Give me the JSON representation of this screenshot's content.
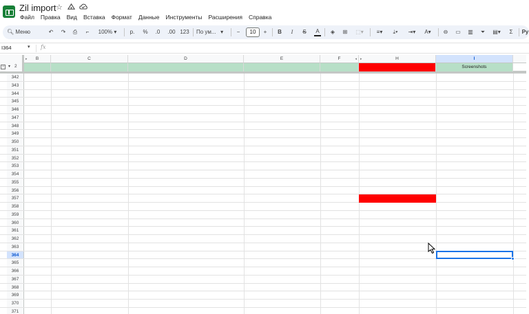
{
  "app": {
    "doc_title": "Zil import",
    "title_icons": [
      "star-icon",
      "move-to-folder-icon",
      "cloud-saved-icon"
    ],
    "menu": [
      "Файл",
      "Правка",
      "Вид",
      "Вставка",
      "Формат",
      "Данные",
      "Инструменты",
      "Расширения",
      "Справка"
    ]
  },
  "toolbar": {
    "search_label": "Меню",
    "zoom": "100%",
    "currency": "р.",
    "percent": "%",
    "dec_decrease": ".0",
    "dec_increase": ".00",
    "number_format": "123",
    "font_name": "По ум...",
    "font_size": "10",
    "bold": "B",
    "italic": "I",
    "strike": "S",
    "text_color": "A",
    "truncated_label": "Py"
  },
  "formula_bar": {
    "cell_ref": "I364",
    "fx": "fx",
    "value": ""
  },
  "sheet": {
    "columns": [
      "B",
      "C",
      "D",
      "E",
      "F",
      "H",
      "I"
    ],
    "selected_column": "I",
    "group_row_number": "2",
    "group_header_label": "Screenshots",
    "rows": [
      "342",
      "343",
      "344",
      "345",
      "346",
      "347",
      "348",
      "349",
      "350",
      "351",
      "352",
      "353",
      "354",
      "355",
      "356",
      "357",
      "358",
      "359",
      "360",
      "361",
      "362",
      "363",
      "364",
      "365",
      "366",
      "367",
      "368",
      "369",
      "370",
      "371"
    ],
    "selected_row": "364",
    "red_highlight_row": "357",
    "colors": {
      "group_band": "#b7dfc7",
      "red_fill": "#ff0000",
      "selection": "#1a73e8",
      "header_selected_bg": "#d3e3fd"
    }
  }
}
